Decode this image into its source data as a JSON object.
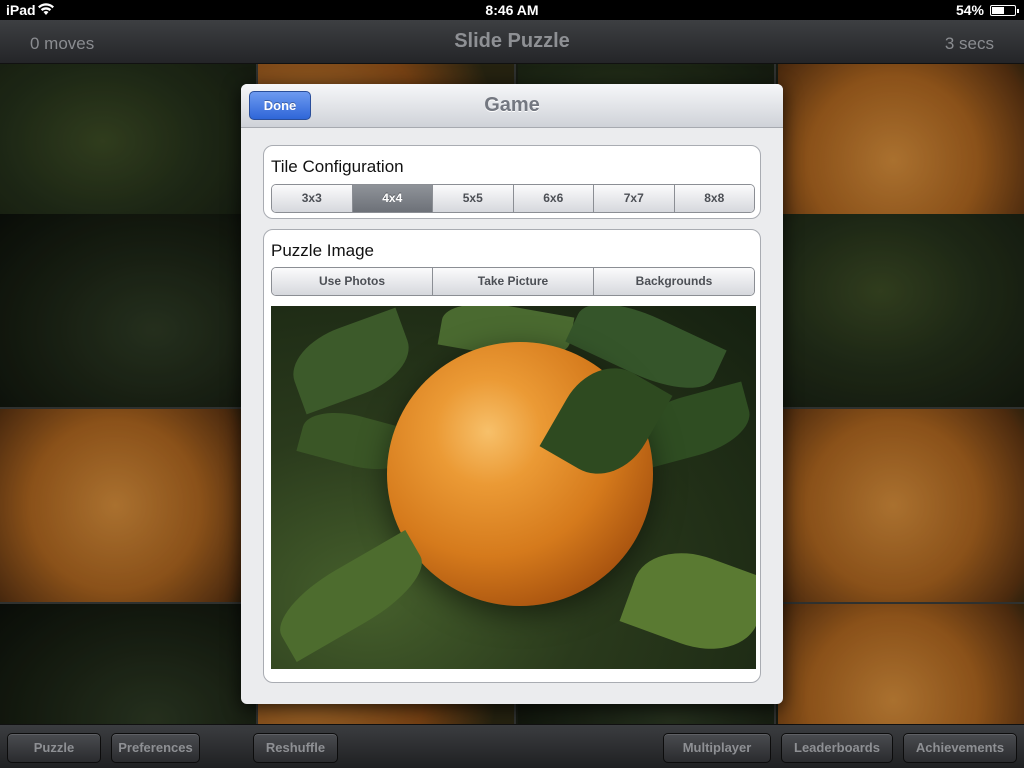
{
  "status_bar": {
    "carrier": "iPad",
    "time": "8:46 AM",
    "battery_percent": "54%",
    "battery_level": 0.54,
    "wifi_icon": "wifi-icon",
    "battery_icon": "battery-icon"
  },
  "nav": {
    "moves": "0 moves",
    "title": "Slide Puzzle",
    "timer": "3 secs"
  },
  "toolbar": {
    "puzzle": "Puzzle",
    "preferences": "Preferences",
    "reshuffle": "Reshuffle",
    "multiplayer": "Multiplayer",
    "leaderboards": "Leaderboards",
    "achievements": "Achievements"
  },
  "popover": {
    "title": "Game",
    "done_label": "Done",
    "tile_config": {
      "title": "Tile Configuration",
      "options": [
        "3x3",
        "4x4",
        "5x5",
        "6x6",
        "7x7",
        "8x8"
      ],
      "selected": "4x4"
    },
    "puzzle_image": {
      "title": "Puzzle Image",
      "options": [
        "Use Photos",
        "Take Picture",
        "Backgrounds"
      ]
    }
  },
  "colors": {
    "done_button": "#2f66d8",
    "segment_selected": "#7a7e85",
    "bar_background": "#2a2b2e"
  }
}
